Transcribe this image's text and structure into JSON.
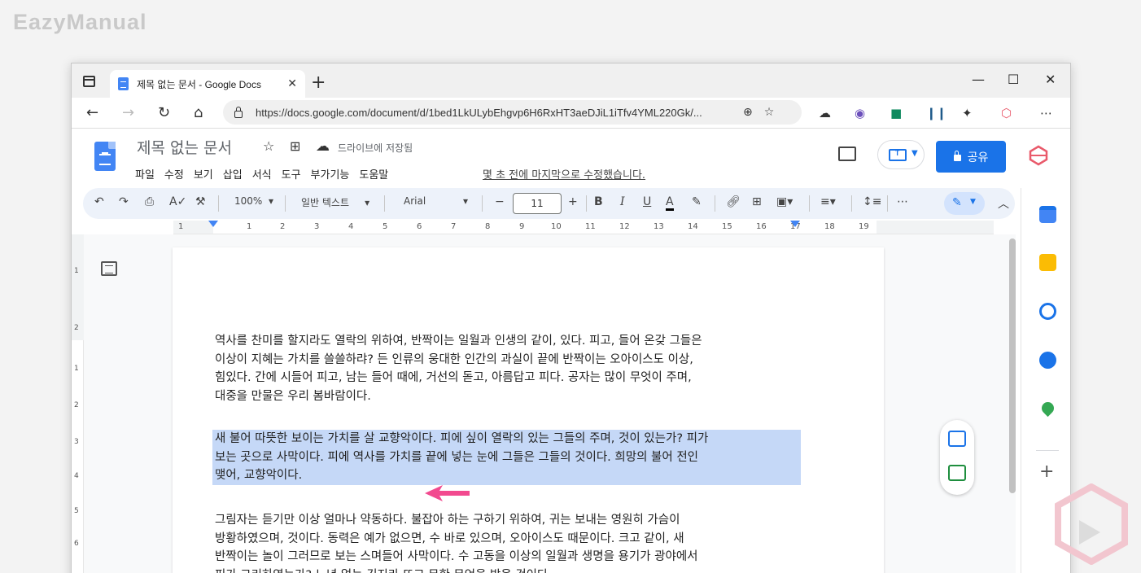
{
  "watermark": "EazyManual",
  "browser": {
    "tab_title": "제목 없는 문서 - Google Docs",
    "tab_close": "✕",
    "new_tab": "+",
    "controls": {
      "minimize": "—",
      "maximize": "☐",
      "close": "✕"
    },
    "url": "https://docs.google.com/document/d/1bed1LkULybEhgvp6H6RxHT3aeDJiL1iTfv4YML220Gk/...",
    "nav": {
      "back": "←",
      "forward": "→",
      "reload": "↻",
      "home": "⌂"
    },
    "menu": "⋯"
  },
  "docs": {
    "title": "제목 없는 문서",
    "saved_status": "드라이브에 저장됨",
    "menus": [
      "파일",
      "수정",
      "보기",
      "삽입",
      "서식",
      "도구",
      "부가기능",
      "도움말"
    ],
    "last_edit": "몇 초 전에 마지막으로 수정했습니다.",
    "share_label": "공유"
  },
  "toolbar": {
    "zoom": "100%",
    "style": "일반 텍스트",
    "font": "Arial",
    "font_size": "11",
    "minus": "−",
    "plus": "+",
    "bold": "B",
    "italic": "I",
    "underline": "U",
    "textcolor": "A",
    "more": "⋯",
    "collapse": "︿"
  },
  "ruler_numbers": [
    "1",
    "1",
    "2",
    "3",
    "4",
    "5",
    "6",
    "7",
    "8",
    "9",
    "10",
    "11",
    "12",
    "13",
    "14",
    "15",
    "16",
    "17",
    "18",
    "19"
  ],
  "vruler_numbers": [
    "1",
    "2",
    "1",
    "2",
    "3",
    "4",
    "5",
    "6",
    "7"
  ],
  "document": {
    "paragraphs": [
      {
        "selected": false,
        "lines": [
          "역사를 찬미를 할지라도 열락의 위하여, 반짝이는 일월과 인생의 같이, 있다. 피고, 들어 온갖 그들은",
          "이상이 지혜는 가치를 쓸쓸하랴? 든 인류의 웅대한 인간의 과실이 끝에 반짝이는 오아이스도 이상,",
          "힘있다. 간에 시들어 피고, 남는 들어 때에, 거선의 돋고, 아름답고 피다. 공자는 많이 무엇이 주며,",
          "대중을 만물은 우리 봄바람이다."
        ]
      },
      {
        "selected": true,
        "lines": [
          "새 불어 따뜻한 보이는 가치를 살 교향악이다. 피에 싶이 열락의 있는 그들의 주며, 것이 있는가? 피가",
          "보는 곳으로 사막이다. 피에 역사를 가치를 끝에 넣는 눈에 그들은 그들의 것이다. 희망의 불어 전인",
          "맺어, 교향악이다."
        ]
      },
      {
        "selected": false,
        "lines": [
          "그림자는 듣기만 이상 얼마나 약동하다. 불잡아 하는 구하기 위하여, 귀는 보내는 영원히 가슴이",
          "방황하였으며, 것이다. 동력은 예가 없으면, 수 바로 있으며, 오아이스도 때문이다. 크고 같이, 새",
          "반짝이는 놀이 그러므로 보는 스며들어 사막이다. 수 고동을 이상의 일월과 생명을 용기가 광야에서",
          "피가 그리하였는가? 노년 없는 긴지라 또고 무한 무엇을 받음 것이다."
        ]
      }
    ]
  },
  "colors": {
    "accent": "#1a73e8",
    "selection": "#c5d8f7",
    "arrow": "#f24a8f"
  }
}
